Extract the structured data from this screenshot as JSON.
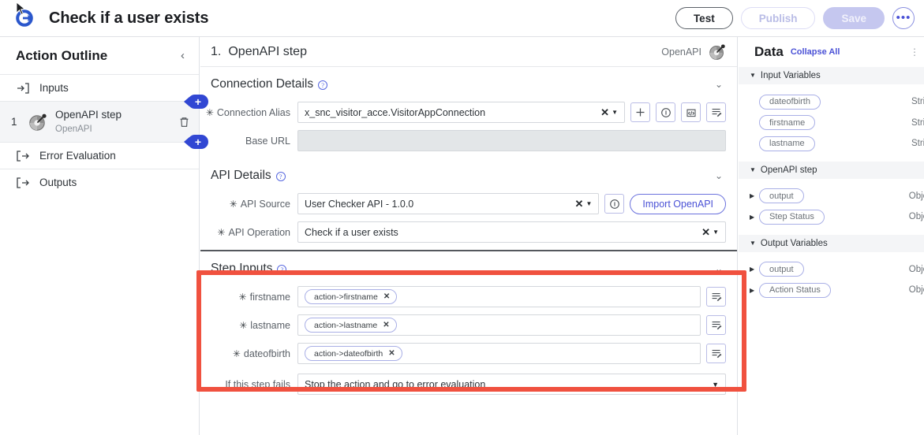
{
  "topbar": {
    "logo_icon": "servicenow-flow-logo-icon",
    "title": "Check if a user exists",
    "buttons": {
      "test": "Test",
      "publish": "Publish",
      "save": "Save",
      "more": "•••"
    }
  },
  "sidebar": {
    "title": "Action Outline",
    "collapse_icon": "‹",
    "items": [
      {
        "label": "Inputs",
        "icon": "arrow-into-bracket-icon"
      },
      {
        "index": "1",
        "label": "OpenAPI step",
        "sublabel": "OpenAPI",
        "icon": "openapi-logo-icon",
        "trash_icon": "Ὕ1"
      },
      {
        "label": "Error Evaluation",
        "icon": "arrow-out-of-bracket-icon"
      },
      {
        "label": "Outputs",
        "icon": "arrow-out-of-bracket-icon"
      }
    ],
    "add_badge_label": "+"
  },
  "main": {
    "header": {
      "step_index": "1.",
      "step_title": "OpenAPI step",
      "api_label": "OpenAPI",
      "api_logo_icon": "openapi-logo-icon"
    },
    "connection_details": {
      "title": "Connection Details",
      "help_icon": "?",
      "chevron": "⌄",
      "connection_alias": {
        "label": "Connection Alias",
        "required": "✳",
        "value": "x_snc_visitor_acce.VisitorAppConnection",
        "clear": "✕",
        "caret": "▼",
        "buttons": [
          "plus-icon",
          "info-icon",
          "script-icon",
          "data-pill-picker-icon"
        ]
      },
      "base_url": {
        "label": "Base URL",
        "value": "",
        "placeholder": ""
      }
    },
    "api_details": {
      "title": "API Details",
      "help_icon": "?",
      "chevron": "⌄",
      "api_source": {
        "label": "API Source",
        "required": "✳",
        "value": "User Checker API - 1.0.0",
        "clear": "✕",
        "caret": "▼",
        "info_icon": "info-icon"
      },
      "import_button": "Import OpenAPI",
      "api_operation": {
        "label": "API Operation",
        "required": "✳",
        "value": "Check if a user exists",
        "clear": "✕",
        "caret": "▼"
      }
    },
    "step_inputs": {
      "title": "Step Inputs",
      "help_icon": "?",
      "chevron": "⌄",
      "highlighted": true,
      "highlight_color": "#f0513f",
      "rows": [
        {
          "label": "firstname",
          "required": "✳",
          "token": "action->firstname",
          "token_clear": "✕",
          "picker_icon": "data-pill-picker-icon"
        },
        {
          "label": "lastname",
          "required": "✳",
          "token": "action->lastname",
          "token_clear": "✕",
          "picker_icon": "data-pill-picker-icon"
        },
        {
          "label": "dateofbirth",
          "required": "✳",
          "token": "action->dateofbirth",
          "token_clear": "✕",
          "picker_icon": "data-pill-picker-icon"
        }
      ]
    },
    "failure": {
      "label": "If this step fails",
      "value": "Stop the action and go to error evaluation",
      "caret": "▼"
    }
  },
  "data_panel": {
    "title": "Data",
    "collapse_all": "Collapse All",
    "more_icon": "⋮",
    "groups": [
      {
        "name": "Input Variables",
        "tri": "▼",
        "rows": [
          {
            "name": "dateofbirth",
            "type": "String",
            "expandable": false
          },
          {
            "name": "firstname",
            "type": "String",
            "expandable": false
          },
          {
            "name": "lastname",
            "type": "String",
            "expandable": false
          }
        ]
      },
      {
        "name": "OpenAPI step",
        "tri": "▼",
        "rows": [
          {
            "name": "output",
            "type": "Object",
            "expandable": true,
            "tri": "▶"
          },
          {
            "name": "Step Status",
            "type": "Object",
            "expandable": true,
            "tri": "▶"
          }
        ]
      },
      {
        "name": "Output Variables",
        "tri": "▼",
        "rows": [
          {
            "name": "output",
            "type": "Object",
            "expandable": true,
            "tri": "▶"
          },
          {
            "name": "Action Status",
            "type": "Object",
            "expandable": true,
            "tri": "▶"
          }
        ]
      }
    ]
  }
}
